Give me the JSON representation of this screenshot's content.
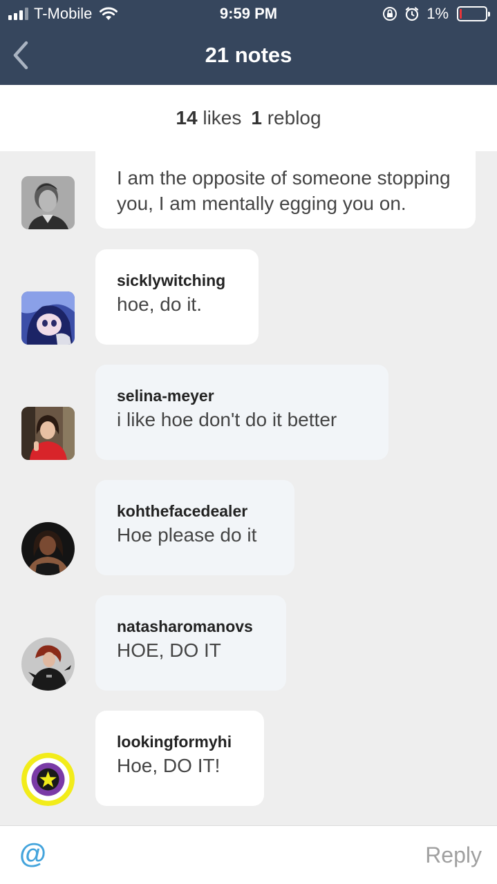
{
  "status_bar": {
    "carrier": "T-Mobile",
    "time": "9:59 PM",
    "battery": "1%",
    "battery_level": 0.01
  },
  "header": {
    "title": "21 notes"
  },
  "counts": {
    "likes_count": "14",
    "likes_label": "likes",
    "reblogs_count": "1",
    "reblogs_label": "reblog"
  },
  "notes": [
    {
      "username": "",
      "text": "I am the opposite of someone stopping you, I am mentally egging you on.",
      "avatar": "man-portrait"
    },
    {
      "username": "sicklywitching",
      "text": "hoe, do it.",
      "avatar": "anime-girl"
    },
    {
      "username": "selina-meyer",
      "text": "i like hoe don't do it better",
      "avatar": "woman-red-dress"
    },
    {
      "username": "kohthefacedealer",
      "text": "Hoe please do it",
      "avatar": "woman-portrait"
    },
    {
      "username": "natasharomanovs",
      "text": "HOE, DO IT",
      "avatar": "black-widow"
    },
    {
      "username": "lookingformyhi",
      "text": "Hoe, DO IT!",
      "avatar": "star-emblem"
    }
  ],
  "reply_bar": {
    "mention_symbol": "@",
    "reply_label": "Reply"
  },
  "colors": {
    "header_bg": "#36465d",
    "mention_accent": "#44a4dc",
    "battery_low": "#e8363a"
  }
}
